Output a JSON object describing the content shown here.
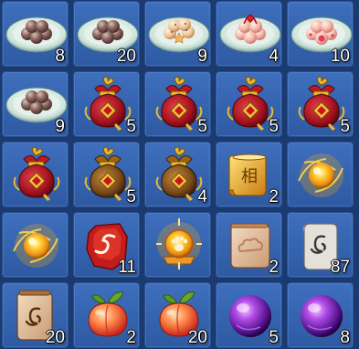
{
  "inventory": {
    "items": [
      {
        "icon": "brown-tangyuan-plate-icon",
        "count": "8"
      },
      {
        "icon": "brown-tangyuan-plate-icon",
        "count": "20"
      },
      {
        "icon": "sesame-tangyuan-plate-icon",
        "count": "9"
      },
      {
        "icon": "red-knot-tangyuan-plate-icon",
        "count": "4"
      },
      {
        "icon": "pink-tangyuan-plate-icon",
        "count": "10"
      },
      {
        "icon": "brown-tangyuan-plate-icon",
        "count": "9"
      },
      {
        "icon": "red-lucky-bag-icon",
        "count": "5"
      },
      {
        "icon": "red-lucky-bag-icon",
        "count": "5"
      },
      {
        "icon": "red-lucky-bag-icon",
        "count": "5"
      },
      {
        "icon": "red-lucky-bag-icon",
        "count": "5"
      },
      {
        "icon": "red-lucky-bag-icon",
        "count": ""
      },
      {
        "icon": "brown-lucky-bag-icon",
        "count": "5"
      },
      {
        "icon": "brown-lucky-bag-icon",
        "count": "4"
      },
      {
        "icon": "golden-scroll-icon",
        "count": "2",
        "glyph": "相"
      },
      {
        "icon": "golden-orb-icon",
        "count": ""
      },
      {
        "icon": "golden-orb-icon",
        "count": ""
      },
      {
        "icon": "red-rune-stone-icon",
        "count": "11"
      },
      {
        "icon": "paw-medallion-icon",
        "count": ""
      },
      {
        "icon": "cloud-scroll-icon",
        "count": "2"
      },
      {
        "icon": "rune-scroll-icon",
        "count": "87"
      },
      {
        "icon": "brown-rune-scroll-icon",
        "count": "20"
      },
      {
        "icon": "peach-icon",
        "count": "2"
      },
      {
        "icon": "peach-icon",
        "count": "20"
      },
      {
        "icon": "purple-orb-icon",
        "count": "5"
      },
      {
        "icon": "purple-orb-icon",
        "count": "8"
      }
    ]
  }
}
